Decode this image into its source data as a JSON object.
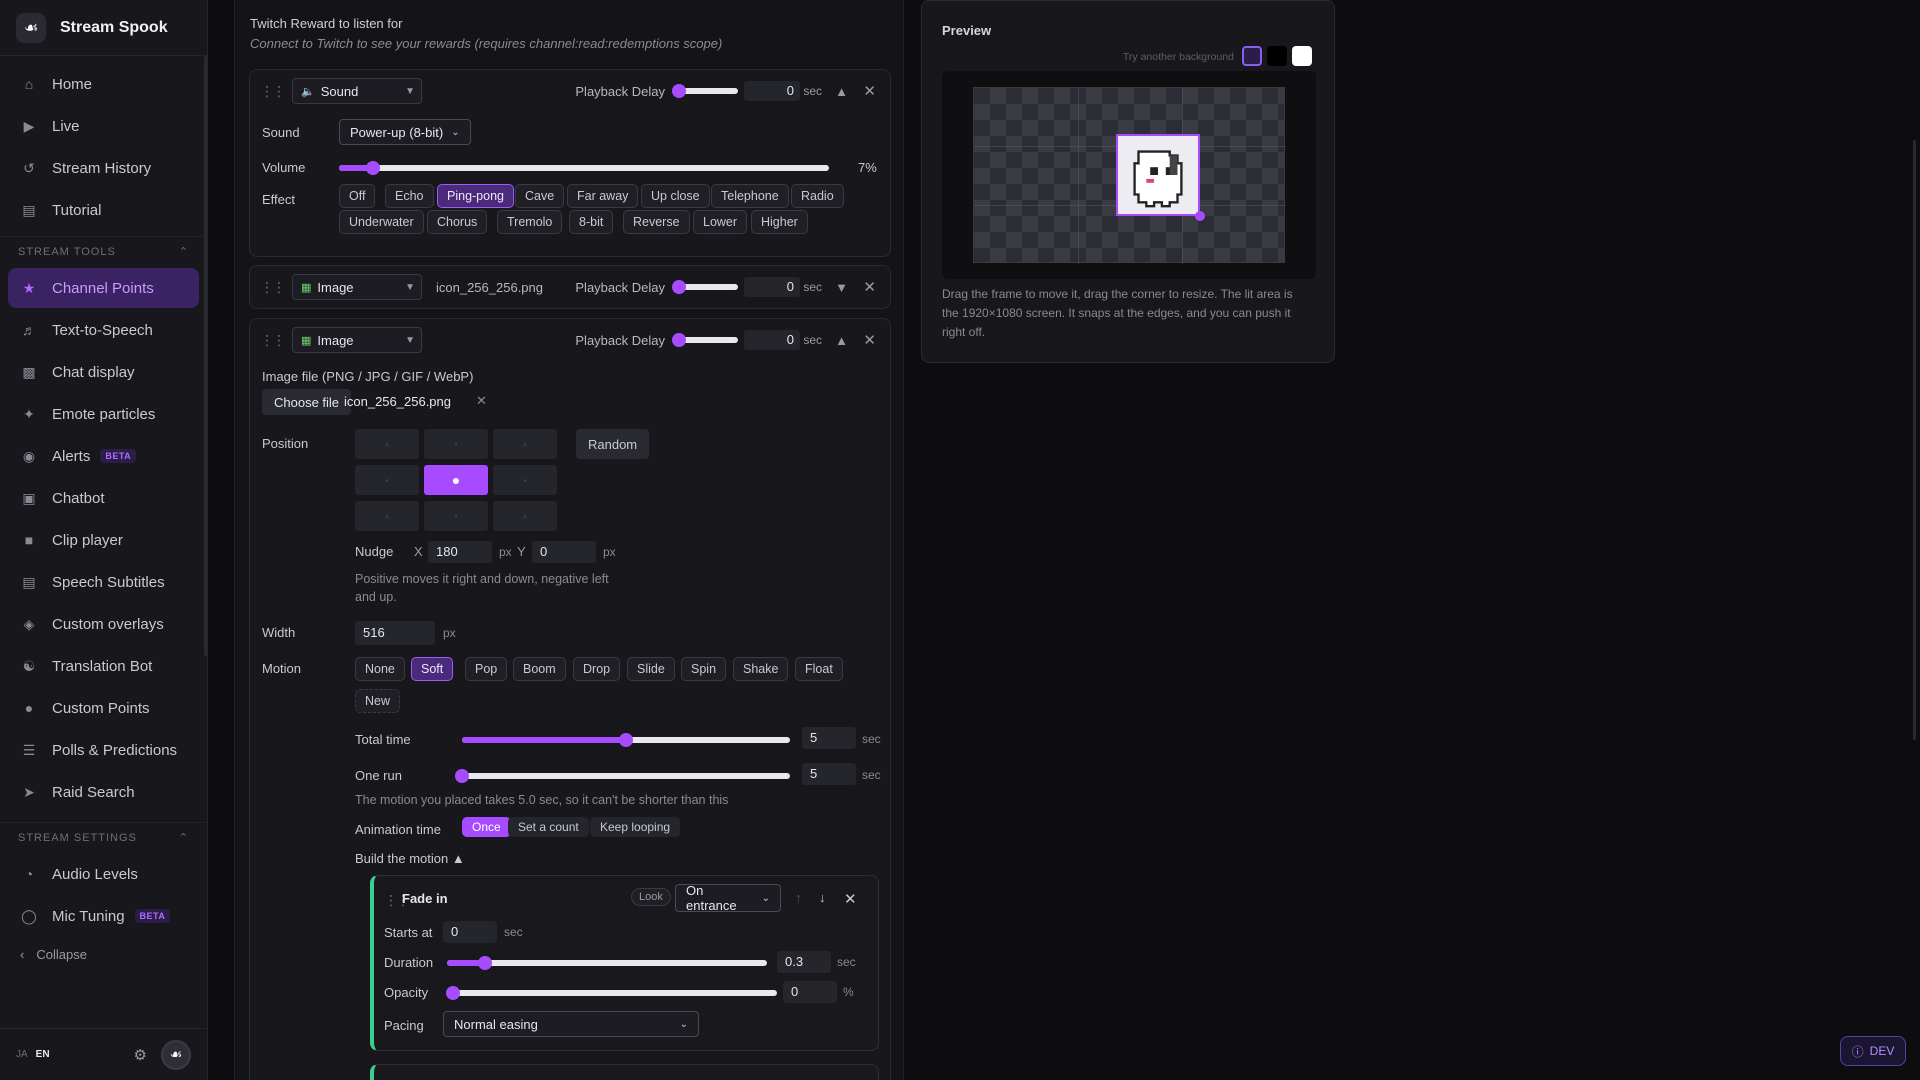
{
  "app": {
    "name": "Stream Spook",
    "logo_icon": "ghost-icon"
  },
  "sidebar": {
    "items": [
      {
        "label": "Home",
        "icon": "home-icon"
      },
      {
        "label": "Live",
        "icon": "play-circle-icon"
      },
      {
        "label": "Stream History",
        "icon": "history-icon"
      },
      {
        "label": "Tutorial",
        "icon": "book-icon"
      }
    ],
    "section_tools": "STREAM TOOLS",
    "tools": [
      {
        "label": "Channel Points",
        "icon": "star-icon",
        "active": true
      },
      {
        "label": "Text-to-Speech",
        "icon": "speaker-icon"
      },
      {
        "label": "Chat display",
        "icon": "chat-display-icon"
      },
      {
        "label": "Emote particles",
        "icon": "sparkle-icon"
      },
      {
        "label": "Alerts",
        "icon": "bell-icon",
        "badge": "BETA"
      },
      {
        "label": "Chatbot",
        "icon": "chat-icon"
      },
      {
        "label": "Clip player",
        "icon": "clip-icon"
      },
      {
        "label": "Speech Subtitles",
        "icon": "subtitles-icon"
      },
      {
        "label": "Custom overlays",
        "icon": "layers-icon"
      },
      {
        "label": "Translation Bot",
        "icon": "translate-icon"
      },
      {
        "label": "Custom Points",
        "icon": "coin-icon"
      },
      {
        "label": "Polls & Predictions",
        "icon": "poll-icon"
      },
      {
        "label": "Raid Search",
        "icon": "send-icon"
      }
    ],
    "section_settings": "STREAM SETTINGS",
    "settings": [
      {
        "label": "Audio Levels",
        "icon": "gauge-icon"
      },
      {
        "label": "Mic Tuning",
        "icon": "mic-icon",
        "badge": "BETA"
      }
    ],
    "collapse": "Collapse",
    "lang_ja": "JA",
    "lang_en": "EN"
  },
  "reward": {
    "title": "Twitch Reward to listen for",
    "hint": "Connect to Twitch to see your rewards (requires channel:read:redemptions scope)"
  },
  "sound_card": {
    "type": "Sound",
    "playback_delay_label": "Playback Delay",
    "delay": "0",
    "unit": "sec",
    "sound_label": "Sound",
    "sound_value": "Power-up (8-bit)",
    "volume_label": "Volume",
    "volume_percent": 7,
    "volume_text": "7%",
    "effect_label": "Effect",
    "effects": [
      "Off",
      "Echo",
      "Ping-pong",
      "Cave",
      "Far away",
      "Up close",
      "Telephone",
      "Radio",
      "Underwater",
      "Chorus",
      "Tremolo",
      "8-bit",
      "Reverse",
      "Lower",
      "Higher"
    ],
    "effect_selected": "Ping-pong"
  },
  "image_card_1": {
    "type": "Image",
    "file": "icon_256_256.png",
    "playback_delay_label": "Playback Delay",
    "delay": "0",
    "unit": "sec"
  },
  "image_card_2": {
    "type": "Image",
    "playback_delay_label": "Playback Delay",
    "delay": "0",
    "unit": "sec",
    "file_label": "Image file (PNG / JPG / GIF / WebP)",
    "choose_file": "Choose file",
    "file": "icon_256_256.png",
    "position_label": "Position",
    "random": "Random",
    "position_selected": "center",
    "nudge_label": "Nudge",
    "x_label": "X",
    "nudge_x": "180",
    "y_label": "Y",
    "nudge_y": "0",
    "px": "px",
    "nudge_hint": "Positive moves it right and down, negative left and up.",
    "width_label": "Width",
    "width": "516",
    "motion_label": "Motion",
    "motions": [
      "None",
      "Soft",
      "Pop",
      "Boom",
      "Drop",
      "Slide",
      "Spin",
      "Shake",
      "Float",
      "New"
    ],
    "motion_selected": "Soft",
    "total_time_label": "Total time",
    "total_time": "5",
    "total_time_fraction": 0.5,
    "one_run_label": "One run",
    "one_run": "5",
    "one_run_fraction": 0.0,
    "motion_hint": "The motion you placed takes 5.0 sec, so it can't be shorter than this",
    "animation_time_label": "Animation time",
    "anim_options": [
      "Once",
      "Set a count",
      "Keep looping"
    ],
    "anim_selected": "Once",
    "build_label": "Build the motion ▲"
  },
  "step": {
    "name": "Fade in",
    "tag": "Look",
    "trigger": "On entrance",
    "starts_at_label": "Starts at",
    "starts_at": "0",
    "duration_label": "Duration",
    "duration": "0.3",
    "duration_fraction": 0.12,
    "opacity_label": "Opacity",
    "opacity": "0",
    "opacity_fraction": 0.0,
    "pacing_label": "Pacing",
    "pacing": "Normal easing",
    "sec": "sec",
    "pct": "%"
  },
  "preview": {
    "title": "Preview",
    "try_bg": "Try another background",
    "swatches": [
      "#2a1d4a",
      "#000000",
      "#ffffff"
    ],
    "description": "Drag the frame to move it, drag the corner to resize. The lit area is the 1920×1080 screen. It snaps at the edges, and you can push it right off."
  },
  "dev_badge": "DEV",
  "colors": {
    "accent": "#a64bff",
    "step_border": "#3ecf8e"
  }
}
